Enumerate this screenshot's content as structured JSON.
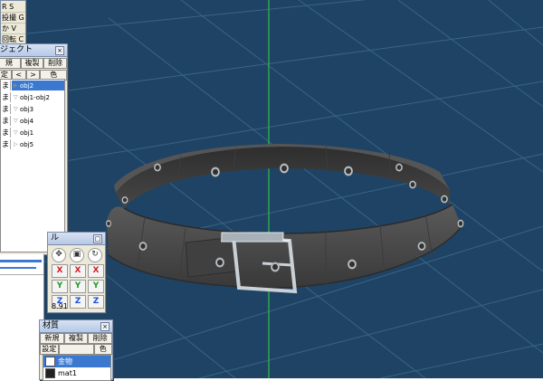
{
  "tools": {
    "rows": [
      "R S",
      "投撮 G",
      "か V",
      "回転 C"
    ]
  },
  "object_panel": {
    "title": "ジェクト",
    "buttons": [
      "規",
      "複製",
      "削除"
    ],
    "buttons2": [
      "定",
      "<",
      ">",
      "色"
    ],
    "items": [
      {
        "name": "obj2",
        "selected": true
      },
      {
        "name": "obj1-obj2",
        "selected": false
      },
      {
        "name": "obj3",
        "selected": false
      },
      {
        "name": "obj4",
        "selected": false
      },
      {
        "name": "obj1",
        "selected": false
      },
      {
        "name": "obj5",
        "selected": false
      }
    ]
  },
  "axis_panel": {
    "title": "ル",
    "rows": [
      [
        "ic",
        "ic",
        "ic"
      ],
      [
        "X",
        "X",
        "X"
      ],
      [
        "Y",
        "Y",
        "Y"
      ],
      [
        "Z",
        "Z",
        "Z"
      ]
    ],
    "value": "8.91"
  },
  "material_panel": {
    "title": "材質",
    "buttons": [
      "新規",
      "複製",
      "削除"
    ],
    "buttons2": [
      "設定",
      "色"
    ],
    "items": [
      {
        "name": "金物",
        "color": "#ffffff",
        "selected": true
      },
      {
        "name": "mat1",
        "color": "#222222",
        "selected": false
      }
    ]
  },
  "viewport": {
    "background": "#1f4364",
    "grid_color": "#3d6a8c",
    "vertical_axis_color": "#2fbf4a",
    "belt_color": "#4a4a4a",
    "buckle_color": "#bfc7cf"
  }
}
